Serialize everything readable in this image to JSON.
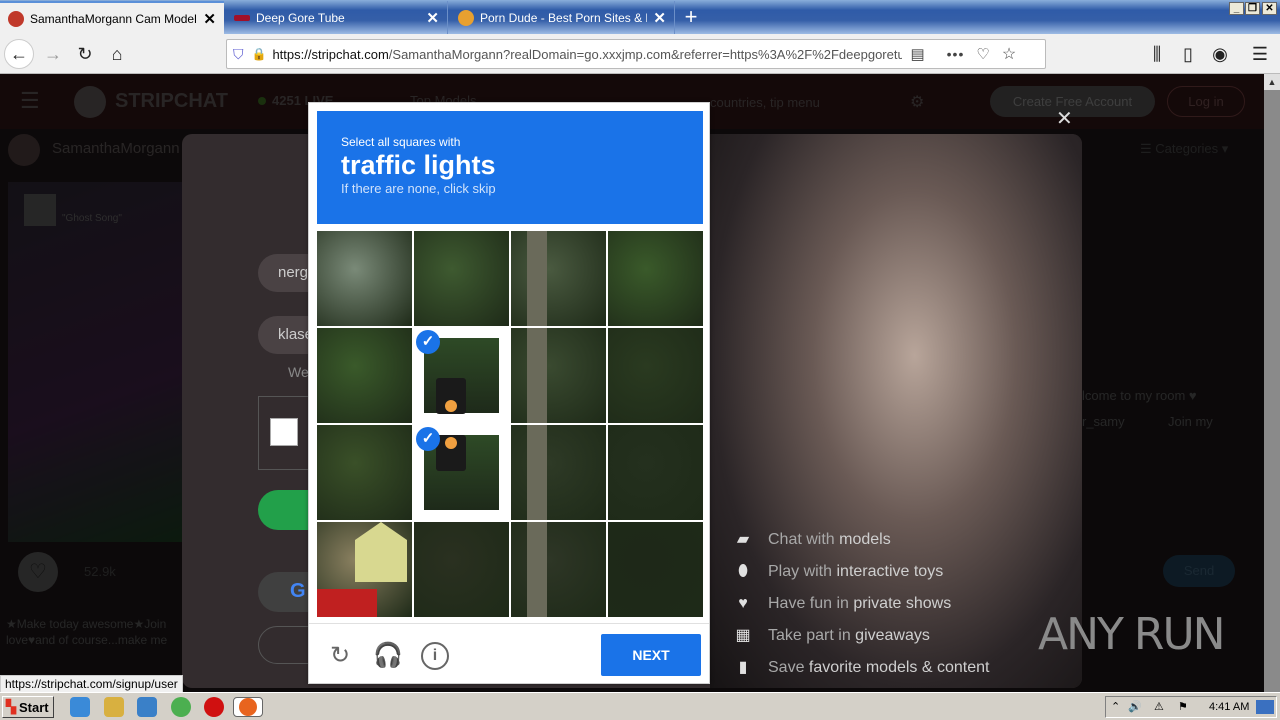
{
  "browser": {
    "tabs": [
      {
        "title": "SamanthaMorgann Cam Model: Fr",
        "active": true,
        "favicon": "stripchat-favicon",
        "color": "#c0392b"
      },
      {
        "title": "Deep Gore Tube",
        "active": false,
        "favicon": "deepgore-favicon",
        "color": "#a0102a"
      },
      {
        "title": "Porn Dude - Best Porn Sites & Free",
        "active": false,
        "favicon": "porndude-favicon",
        "color": "#e8a030"
      }
    ],
    "new_tab": "+",
    "url_host": "https://stripchat.com",
    "url_rest": "/SamanthaMorgann?realDomain=go.xxxjmp.com&referrer=https%3A%2F%2Fdeepgoretu",
    "window_controls": {
      "minimize": "_",
      "restore": "❐",
      "close": "✕"
    },
    "status_url": "https://stripchat.com/signup/user"
  },
  "site": {
    "logo": "STRIPCHAT",
    "live_count": "4251 LIVE",
    "top_models": "Top Models",
    "search_placeholder": "countries, tip menu",
    "create_account": "Create Free Account",
    "login": "Log in",
    "model_name": "SamanthaMorgann",
    "categories": "Categories",
    "song": "\"Ghost Song\"",
    "likes": "52.9k",
    "bio_line1": "★Make today awesome★Join",
    "bio_line2": "love♥and of course...make me",
    "chat_line1": "lcome to my room ♥",
    "chat_line2": "r_samy",
    "chat_line2b": "Join my",
    "send": "Send"
  },
  "signup": {
    "field1_value": "nerg",
    "field2_value": "klase",
    "welcome_fragment": "We",
    "close": "✕",
    "features": [
      {
        "icon": "chat-icon",
        "glyph": "💬",
        "lite": "Chat with",
        "bold": "models"
      },
      {
        "icon": "toy-icon",
        "glyph": "✎",
        "lite": "Play with",
        "bold": "interactive toys"
      },
      {
        "icon": "heart-icon",
        "glyph": "♥",
        "lite": "Have fun in",
        "bold": "private shows"
      },
      {
        "icon": "gift-icon",
        "glyph": "🎁",
        "lite": "Take part in",
        "bold": "giveaways"
      },
      {
        "icon": "bookmark-icon",
        "glyph": "🔖",
        "lite": "Save",
        "bold": "favorite models & content"
      }
    ]
  },
  "captcha": {
    "prompt": "Select all squares with",
    "target": "traffic lights",
    "hint": "If there are none, click skip",
    "selected_tiles": [
      5,
      9
    ],
    "next": "NEXT",
    "reload_label": "reload",
    "audio_label": "audio",
    "info_label": "info"
  },
  "watermark": "ANY RUN",
  "taskbar": {
    "start": "Start",
    "time": "4:41 AM"
  }
}
